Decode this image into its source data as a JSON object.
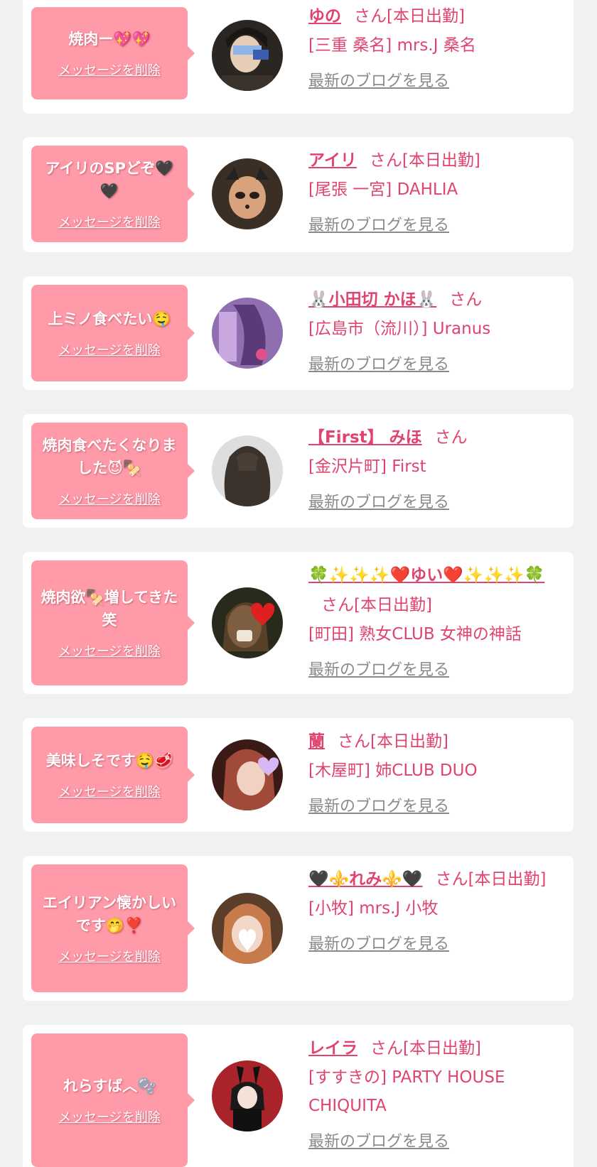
{
  "delete_label": "メッセージを削除",
  "blog_label": "最新のブログを見る",
  "colors": {
    "bubble": "#ff9aa9",
    "accent": "#e0446e",
    "link_gray": "#8a8a8a",
    "page_bg": "#f1f1f1"
  },
  "items": [
    {
      "message": "焼肉ー💖💖",
      "name": "ゆの",
      "suffix": "さん[本日出勤]",
      "shop": "[三重 桑名] mrs.J 桑名",
      "avatar_icon": "profile-photo"
    },
    {
      "message": "アイリのSPどぞ🖤🖤",
      "name": "アイリ",
      "suffix": "さん[本日出勤]",
      "shop": "[尾張 一宮] DAHLIA",
      "avatar_icon": "profile-photo"
    },
    {
      "message": "上ミノ食べたい🤤",
      "name": "🐰小田切 かほ🐰",
      "suffix": "さん",
      "shop": "[広島市（流川）] Uranus",
      "avatar_icon": "profile-photo"
    },
    {
      "message": "焼肉食べたくなりました😈🍢",
      "name": "【First】 みほ",
      "suffix": "さん",
      "shop": "[金沢片町] First",
      "avatar_icon": "profile-photo"
    },
    {
      "message": "焼肉欲🍢増してきた笑",
      "name": "🍀✨✨✨❤️ゆい❤️✨✨✨🍀",
      "suffix": "さん[本日出勤]",
      "shop": "[町田] 熟女CLUB 女神の神話",
      "avatar_icon": "profile-photo"
    },
    {
      "message": "美味しそです🤤🥩",
      "name": "蘭",
      "suffix": "さん[本日出勤]",
      "shop": "[木屋町] 姉CLUB DUO",
      "avatar_icon": "profile-photo"
    },
    {
      "message": "エイリアン懐かしいです🤭❣️",
      "name": "🖤⚜️れみ⚜️🖤",
      "suffix": "さん[本日出勤]",
      "shop": "[小牧] mrs.J 小牧",
      "avatar_icon": "profile-photo"
    },
    {
      "message": "れらすば︿🫧",
      "name": "レイラ",
      "suffix": "さん[本日出勤]",
      "shop": "[すすきの] PARTY HOUSE CHIQUITA",
      "avatar_icon": "profile-photo"
    }
  ]
}
